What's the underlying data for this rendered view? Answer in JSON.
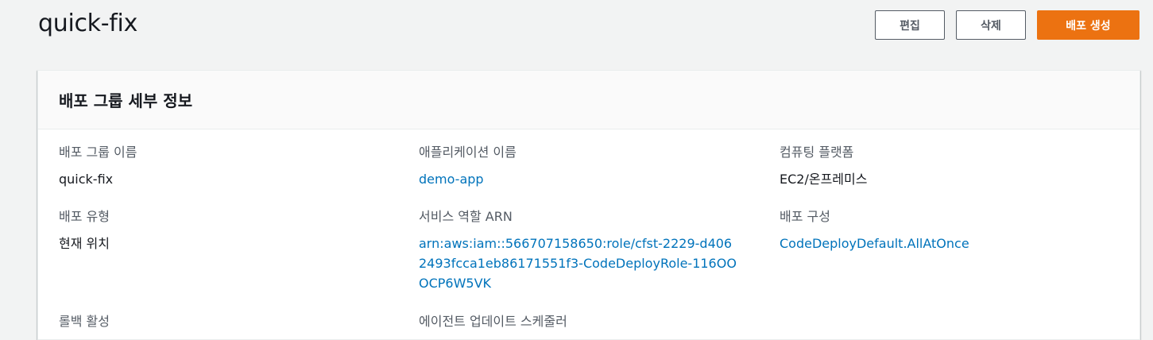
{
  "header": {
    "title": "quick-fix",
    "edit_label": "편집",
    "delete_label": "삭제",
    "create_deployment_label": "배포 생성"
  },
  "panel": {
    "title": "배포 그룹 세부 정보",
    "fields": {
      "deployment_group_name": {
        "label": "배포 그룹 이름",
        "value": "quick-fix"
      },
      "application_name": {
        "label": "애플리케이션 이름",
        "value": "demo-app"
      },
      "compute_platform": {
        "label": "컴퓨팅 플랫폼",
        "value": "EC2/온프레미스"
      },
      "deployment_type": {
        "label": "배포 유형",
        "value": "현재 위치"
      },
      "service_role_arn": {
        "label": "서비스 역할 ARN",
        "value": "arn:aws:iam::566707158650:role/cfst-2229-d4062493fcca1eb86171551f3-CodeDeployRole-116OOOCP6W5VK"
      },
      "deployment_config": {
        "label": "배포 구성",
        "value": "CodeDeployDefault.AllAtOnce"
      },
      "rollback_enabled": {
        "label": "롤백 활성"
      },
      "agent_update_scheduler": {
        "label": "에이전트 업데이트 스케줄러"
      }
    }
  },
  "colors": {
    "primary": "#ec7211",
    "link": "#0073bb",
    "background": "#f2f3f3"
  }
}
